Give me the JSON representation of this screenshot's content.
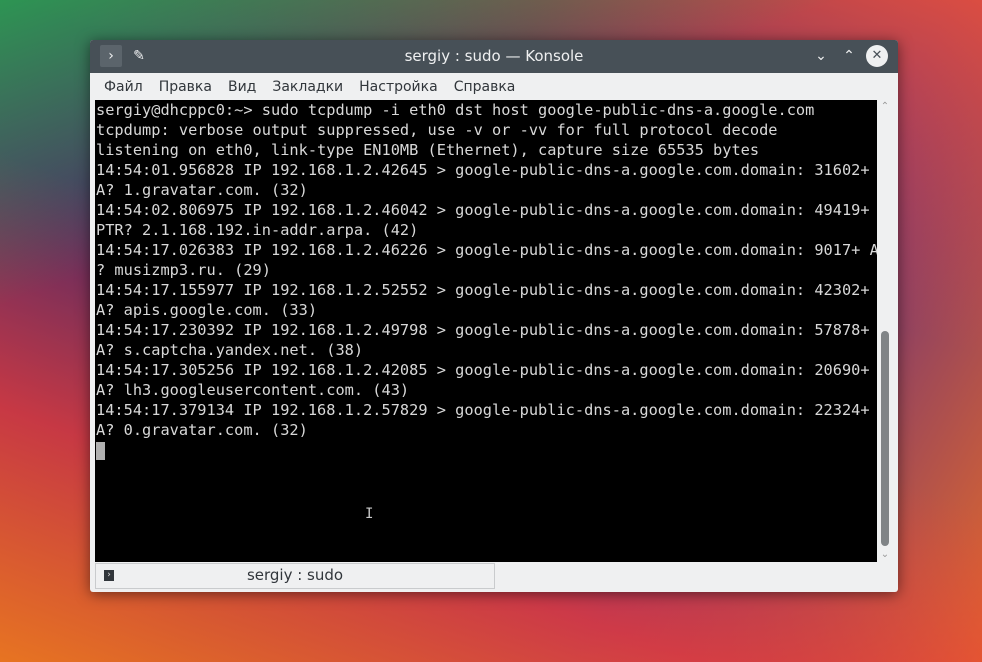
{
  "window": {
    "title": "sergiy : sudo — Konsole"
  },
  "menu": [
    "Файл",
    "Правка",
    "Вид",
    "Закладки",
    "Настройка",
    "Справка"
  ],
  "terminal": {
    "lines": [
      "sergiy@dhcppc0:~> sudo tcpdump -i eth0 dst host google-public-dns-a.google.com",
      "tcpdump: verbose output suppressed, use -v or -vv for full protocol decode",
      "listening on eth0, link-type EN10MB (Ethernet), capture size 65535 bytes",
      "14:54:01.956828 IP 192.168.1.2.42645 > google-public-dns-a.google.com.domain: 31602+",
      "A? 1.gravatar.com. (32)",
      "14:54:02.806975 IP 192.168.1.2.46042 > google-public-dns-a.google.com.domain: 49419+",
      "PTR? 2.1.168.192.in-addr.arpa. (42)",
      "14:54:17.026383 IP 192.168.1.2.46226 > google-public-dns-a.google.com.domain: 9017+ A",
      "? musizmp3.ru. (29)",
      "14:54:17.155977 IP 192.168.1.2.52552 > google-public-dns-a.google.com.domain: 42302+",
      "A? apis.google.com. (33)",
      "14:54:17.230392 IP 192.168.1.2.49798 > google-public-dns-a.google.com.domain: 57878+",
      "A? s.captcha.yandex.net. (38)",
      "14:54:17.305256 IP 192.168.1.2.42085 > google-public-dns-a.google.com.domain: 20690+",
      "A? lh3.googleusercontent.com. (43)",
      "14:54:17.379134 IP 192.168.1.2.57829 > google-public-dns-a.google.com.domain: 22324+",
      "A? 0.gravatar.com. (32)"
    ]
  },
  "scrollbar": {
    "position_fraction": 1.0,
    "visible_fraction": 0.5
  },
  "tab": {
    "label": "sergiy : sudo"
  }
}
